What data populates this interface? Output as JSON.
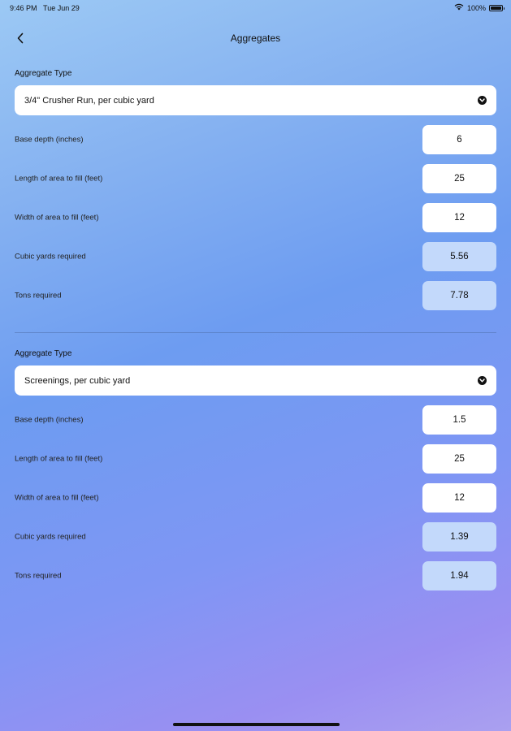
{
  "status_bar": {
    "time": "9:46 PM",
    "date": "Tue Jun 29",
    "battery": "100%",
    "icons": [
      "wifi-icon",
      "battery-icon"
    ]
  },
  "nav": {
    "title": "Aggregates",
    "back_icon": "chevron-left-icon"
  },
  "sections": [
    {
      "type_label": "Aggregate Type",
      "selected_type": "3/4\" Crusher Run, per cubic yard",
      "rows": [
        {
          "label": "Base depth (inches)",
          "value": "6"
        },
        {
          "label": "Length of area to fill (feet)",
          "value": "25"
        },
        {
          "label": "Width of area to fill (feet)",
          "value": "12"
        },
        {
          "label": "Cubic yards required",
          "value": "5.56"
        },
        {
          "label": "Tons required",
          "value": "7.78"
        }
      ]
    },
    {
      "type_label": "Aggregate Type",
      "selected_type": "Screenings, per cubic yard",
      "rows": [
        {
          "label": "Base depth (inches)",
          "value": "1.5"
        },
        {
          "label": "Length of area to fill (feet)",
          "value": "25"
        },
        {
          "label": "Width of area to fill (feet)",
          "value": "12"
        },
        {
          "label": "Cubic yards required",
          "value": "1.39"
        },
        {
          "label": "Tons required",
          "value": "1.94"
        }
      ]
    }
  ],
  "colors": {
    "input_bg": "#ffffff",
    "result_bg": "#c3d9fb",
    "gradient_top": "#9cc9f4",
    "gradient_bottom": "#aaa0f0"
  }
}
